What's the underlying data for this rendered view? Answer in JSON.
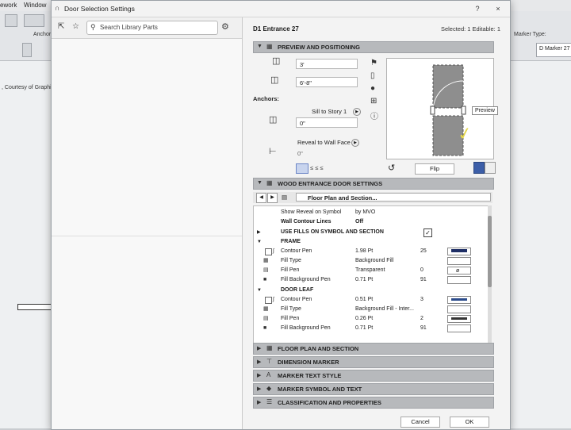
{
  "background": {
    "menu": [
      "ework",
      "Window"
    ],
    "anchor_label": "Anchor",
    "marker_type_label": "Marker Type:",
    "marker_value": "D Marker 27",
    "courtesy_text": ", Courtesy of Graphi"
  },
  "dialog": {
    "title": "Door Selection Settings",
    "help_label": "?",
    "close_label": "×"
  },
  "left": {
    "search_placeholder": "Search Library Parts"
  },
  "right": {
    "object_name": "D1 Entrance 27",
    "selection_info": "Selected: 1 Editable: 1",
    "preview_section": "PREVIEW AND POSITIONING",
    "width_value": "3'",
    "height_value": "6'-8\"",
    "anchors_label": "Anchors:",
    "sill_anchor": "Sill to Story 1",
    "sill_value": "0\"",
    "reveal_anchor": "Reveal to Wall Face",
    "reveal_value": "0\"",
    "preview_tooltip": "Preview",
    "flip_label": "Flip",
    "settings_section": "WOOD ENTRANCE DOOR SETTINGS",
    "floor_plan_select": "Floor Plan and Section...",
    "params": [
      {
        "label": "Show Reveal on Symbol",
        "value": "by MVO"
      },
      {
        "label": "Wall Contour Lines",
        "value": "Off"
      },
      {
        "label": "USE FILLS ON SYMBOL AND SECTION",
        "value": "✓"
      },
      {
        "label": "FRAME",
        "value": ""
      },
      {
        "label": "Contour Pen",
        "value": "1.98 Pt",
        "num": "25"
      },
      {
        "label": "Fill Type",
        "value": "Background Fill",
        "num": ""
      },
      {
        "label": "Fill Pen",
        "value": "Transparent",
        "num": "0"
      },
      {
        "label": "Fill Background Pen",
        "value": "0.71 Pt",
        "num": "91"
      },
      {
        "label": "DOOR LEAF",
        "value": ""
      },
      {
        "label": "Contour Pen",
        "value": "0.51 Pt",
        "num": "3"
      },
      {
        "label": "Fill Type",
        "value": "Background Fill - Inter...",
        "num": ""
      },
      {
        "label": "Fill Pen",
        "value": "0.26 Pt",
        "num": "2"
      },
      {
        "label": "Fill Background Pen",
        "value": "0.71 Pt",
        "num": "91"
      }
    ],
    "collapsed_sections": [
      "FLOOR PLAN AND SECTION",
      "DIMENSION MARKER",
      "MARKER TEXT STYLE",
      "MARKER SYMBOL AND TEXT",
      "CLASSIFICATION AND PROPERTIES"
    ],
    "cancel_label": "Cancel",
    "ok_label": "OK"
  }
}
